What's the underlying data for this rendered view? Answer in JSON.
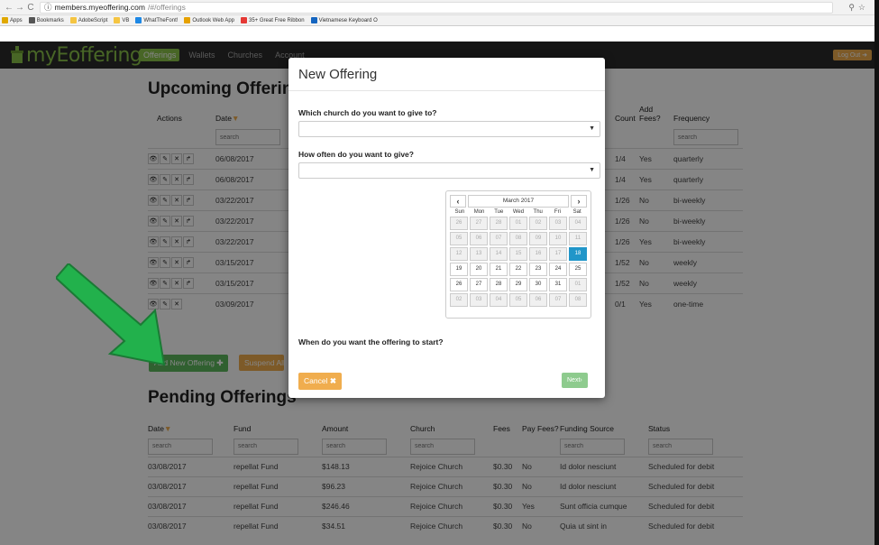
{
  "browser": {
    "url_host": "members.myeoffering.com",
    "url_path": "/#/offerings",
    "bookmarks": [
      {
        "label": "Apps",
        "color": "#e0a800"
      },
      {
        "label": "Bookmarks",
        "color": "#555555"
      },
      {
        "label": "AdobeScript",
        "color": "#f5c542"
      },
      {
        "label": "VB",
        "color": "#f5c542"
      },
      {
        "label": "WhatTheFont!",
        "color": "#1e88e5"
      },
      {
        "label": "Outlook Web App",
        "color": "#e6a100"
      },
      {
        "label": "35+ Great Free Ribbon",
        "color": "#e53935"
      },
      {
        "label": "Vietnamese Keyboard O",
        "color": "#1565c0"
      }
    ]
  },
  "navbar": {
    "brand": "myEoffering",
    "links": [
      "Offerings",
      "Wallets",
      "Churches",
      "Account"
    ],
    "logout": "Log Out"
  },
  "upcoming": {
    "title": "Upcoming Offerings",
    "columns": {
      "actions": "Actions",
      "date": "Date",
      "count": "Count",
      "add_fees": "Add Fees?",
      "frequency": "Frequency"
    },
    "search_placeholder": "search",
    "rows": [
      {
        "date": "06/08/2017",
        "count": "1/4",
        "fees": "Yes",
        "freq": "quarterly"
      },
      {
        "date": "06/08/2017",
        "count": "1/4",
        "fees": "Yes",
        "freq": "quarterly"
      },
      {
        "date": "03/22/2017",
        "count": "1/26",
        "fees": "No",
        "freq": "bi-weekly"
      },
      {
        "date": "03/22/2017",
        "count": "1/26",
        "fees": "No",
        "freq": "bi-weekly"
      },
      {
        "date": "03/22/2017",
        "count": "1/26",
        "fees": "Yes",
        "freq": "bi-weekly"
      },
      {
        "date": "03/15/2017",
        "count": "1/52",
        "fees": "No",
        "freq": "weekly"
      },
      {
        "date": "03/15/2017",
        "count": "1/52",
        "fees": "No",
        "freq": "weekly"
      },
      {
        "date": "03/09/2017",
        "count": "0/1",
        "fees": "Yes",
        "freq": "one-time"
      }
    ],
    "add_button": "Add New Offering",
    "suspend_button": "Suspend All"
  },
  "pending": {
    "title": "Pending Offerings",
    "columns": {
      "date": "Date",
      "fund": "Fund",
      "amount": "Amount",
      "church": "Church",
      "fees": "Fees",
      "pay_fees": "Pay Fees?",
      "source": "Funding Source",
      "status": "Status"
    },
    "rows": [
      {
        "date": "03/08/2017",
        "fund": "repellat Fund",
        "amount": "$148.13",
        "church": "Rejoice Church",
        "fees": "$0.30",
        "pay": "No",
        "source": "Id dolor nesciunt",
        "status": "Scheduled for debit"
      },
      {
        "date": "03/08/2017",
        "fund": "repellat Fund",
        "amount": "$96.23",
        "church": "Rejoice Church",
        "fees": "$0.30",
        "pay": "No",
        "source": "Id dolor nesciunt",
        "status": "Scheduled for debit"
      },
      {
        "date": "03/08/2017",
        "fund": "repellat Fund",
        "amount": "$246.46",
        "church": "Rejoice Church",
        "fees": "$0.30",
        "pay": "Yes",
        "source": "Sunt officia cumque",
        "status": "Scheduled for debit"
      },
      {
        "date": "03/08/2017",
        "fund": "repellat Fund",
        "amount": "$34.51",
        "church": "Rejoice Church",
        "fees": "$0.30",
        "pay": "No",
        "source": "Quia ut sint in",
        "status": "Scheduled for debit"
      }
    ]
  },
  "modal": {
    "title": "New Offering",
    "q_church": "Which church do you want to give to?",
    "q_frequency": "How often do you want to give?",
    "q_start": "When do you want the offering to start?",
    "cancel": "Cancel",
    "next": "Next",
    "calendar": {
      "month": "March 2017",
      "dows": [
        "Sun",
        "Mon",
        "Tue",
        "Wed",
        "Thu",
        "Fri",
        "Sat"
      ],
      "weeks": [
        [
          "26",
          "27",
          "28",
          "01",
          "02",
          "03",
          "04"
        ],
        [
          "05",
          "06",
          "07",
          "08",
          "09",
          "10",
          "11"
        ],
        [
          "12",
          "13",
          "14",
          "15",
          "16",
          "17",
          "18"
        ],
        [
          "19",
          "20",
          "21",
          "22",
          "23",
          "24",
          "25"
        ],
        [
          "26",
          "27",
          "28",
          "29",
          "30",
          "31",
          "01"
        ],
        [
          "02",
          "03",
          "04",
          "05",
          "06",
          "07",
          "08"
        ]
      ],
      "selected": "18"
    }
  },
  "colors": {
    "brand_green": "#8bc34a",
    "button_green": "#5cb85c",
    "button_orange": "#f0ad4e",
    "selected_blue": "#2196c9",
    "arrow_green": "#22b14c"
  }
}
